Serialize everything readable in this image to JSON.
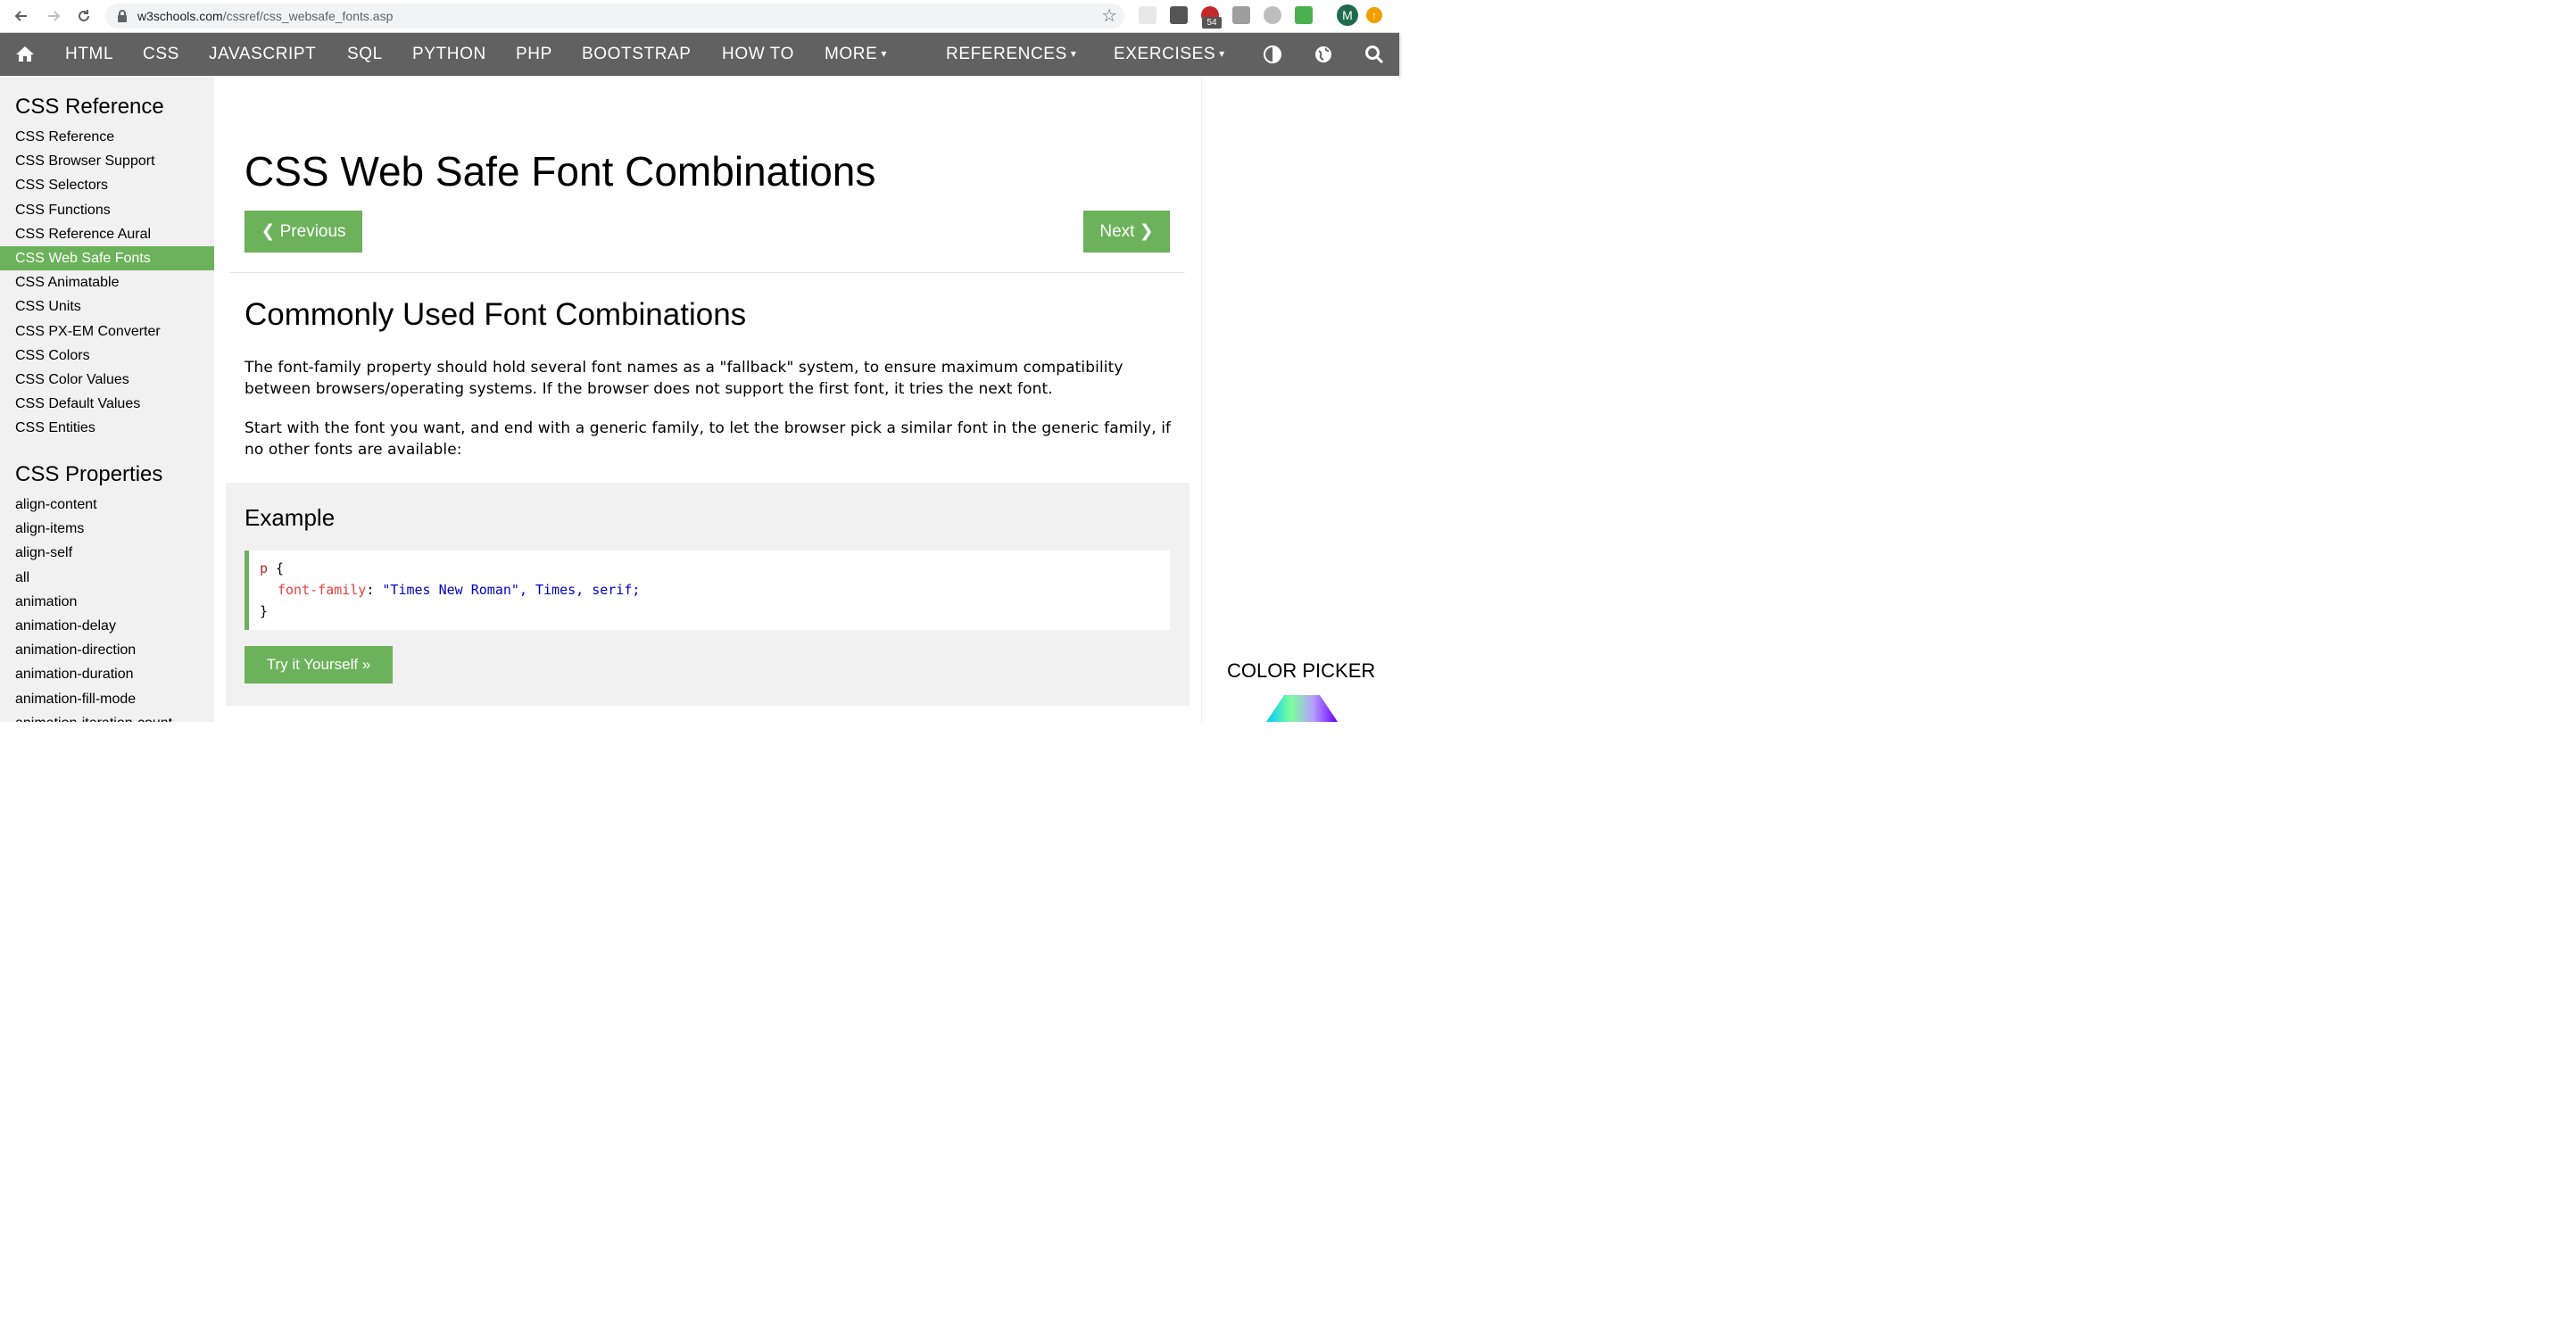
{
  "browser": {
    "url_domain": "w3schools.com",
    "url_path": "/cssref/css_websafe_fonts.asp",
    "extension_badge": "54",
    "profile_initial": "M"
  },
  "topnav": {
    "items": [
      "HTML",
      "CSS",
      "JAVASCRIPT",
      "SQL",
      "PYTHON",
      "PHP",
      "BOOTSTRAP",
      "HOW TO",
      "MORE",
      "REFERENCES",
      "EXERCISES"
    ],
    "caret": "▾"
  },
  "sidebar": {
    "section1_title": "CSS Reference",
    "section1_links": [
      "CSS Reference",
      "CSS Browser Support",
      "CSS Selectors",
      "CSS Functions",
      "CSS Reference Aural",
      "CSS Web Safe Fonts",
      "CSS Animatable",
      "CSS Units",
      "CSS PX-EM Converter",
      "CSS Colors",
      "CSS Color Values",
      "CSS Default Values",
      "CSS Entities"
    ],
    "active_index": 5,
    "section2_title": "CSS Properties",
    "section2_links": [
      "align-content",
      "align-items",
      "align-self",
      "all",
      "animation",
      "animation-delay",
      "animation-direction",
      "animation-duration",
      "animation-fill-mode",
      "animation-iteration-count"
    ]
  },
  "main": {
    "title": "CSS Web Safe Font Combinations",
    "prev_label": "❮ Previous",
    "next_label": "Next ❯",
    "section_title": "Commonly Used Font Combinations",
    "para1": "The font-family property should hold several font names as a \"fallback\" system, to ensure maximum compatibility between browsers/operating systems. If the browser does not support the first font, it tries the next font.",
    "para2": "Start with the font you want, and end with a generic family, to let the browser pick a similar font in the generic family, if no other fonts are available:",
    "example": {
      "title": "Example",
      "code_selector": "p",
      "code_open": " {",
      "code_property": "font-family",
      "code_colon": ": ",
      "code_value": "\"Times New Roman\", Times, serif;",
      "code_close": "}",
      "try_label": "Try it Yourself »"
    }
  },
  "right": {
    "color_picker_title": "COLOR PICKER"
  },
  "colors": {
    "nav_bg": "#616161",
    "green": "#6bb25a",
    "sidebar_bg": "#f1f1f1"
  }
}
